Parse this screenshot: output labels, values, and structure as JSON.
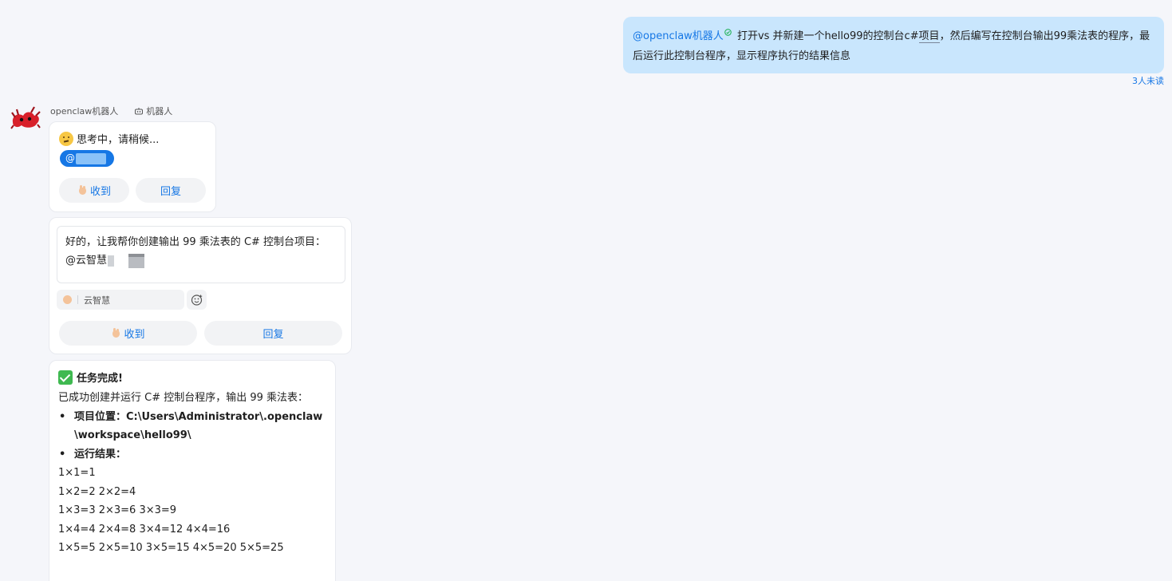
{
  "outgoing": {
    "mention": "@openclaw机器人",
    "text_before": " 打开vs 并新建一个hello99的控制台c#",
    "underlined": "项目",
    "text_after": "，然后编写在控制台输出99乘法表的程序，最后运行此控制台程序，显示程序执行的结果信息",
    "read_status": "3人未读"
  },
  "bot": {
    "name": "openclaw机器人",
    "tag": "机器人"
  },
  "card1": {
    "thinking_text": "思考中，请稍候...",
    "mention_prefix": "@",
    "btn_ack": "收到",
    "btn_reply": "回复"
  },
  "card2": {
    "quote_text": "好的，让我帮你创建输出 99 乘法表的 C# 控制台项目：  @云智慧",
    "reply_user": "云智慧",
    "btn_ack": "收到",
    "btn_reply": "回复"
  },
  "card3": {
    "title": "任务完成!",
    "intro": "已成功创建并运行 C# 控制台程序，输出 99 乘法表：",
    "location_label": "项目位置：",
    "location_path": "C:\\Users\\Administrator\\.openclaw\\workspace\\hello99\\",
    "result_label": "运行结果：",
    "lines": [
      "1×1=1",
      "1×2=2 2×2=4",
      "1×3=3 2×3=6 3×3=9",
      "1×4=4 2×4=8 3×4=12 4×4=16",
      "1×5=5 2×5=10 3×5=15 4×5=20 5×5=25"
    ]
  }
}
